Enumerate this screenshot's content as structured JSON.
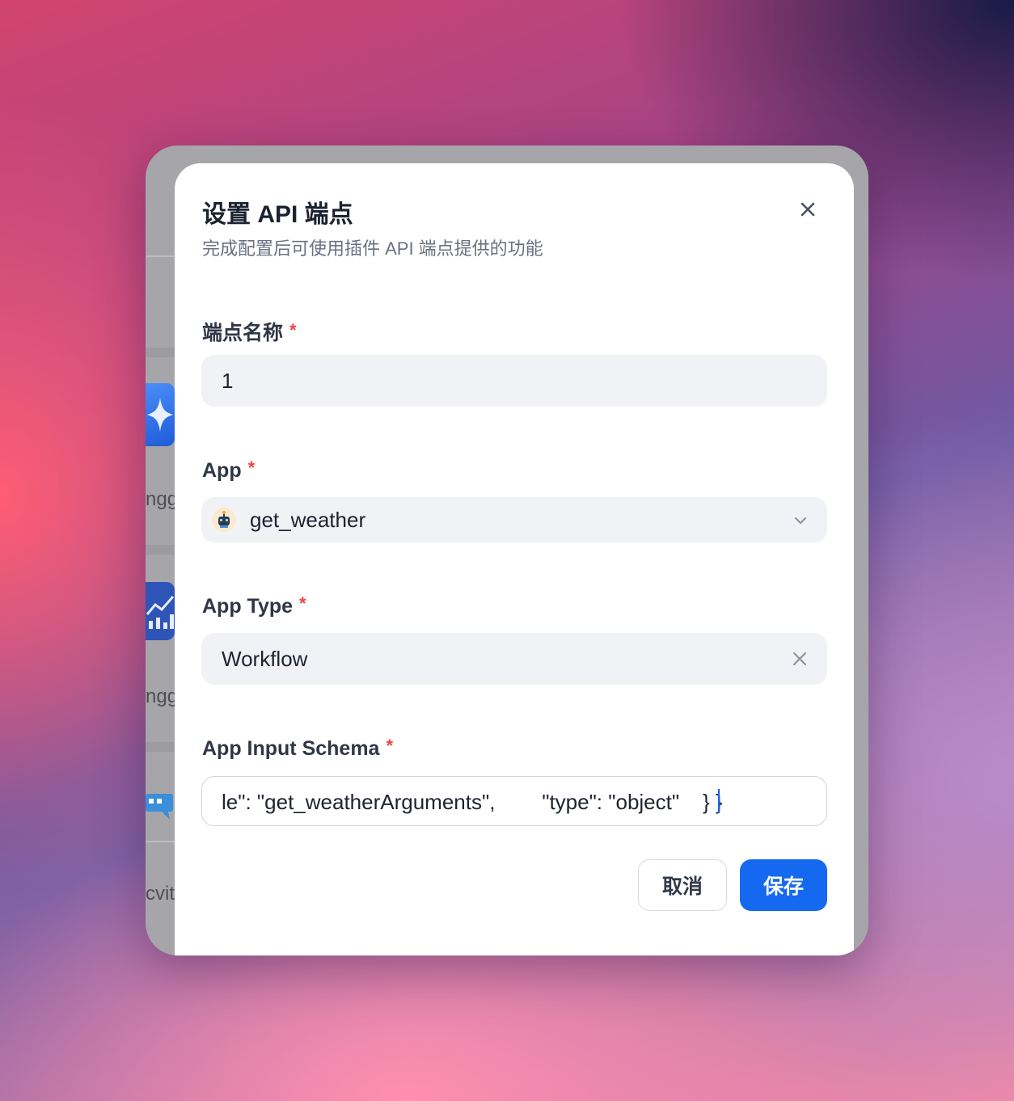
{
  "dialog": {
    "title": "设置 API 端点",
    "subtitle": "完成配置后可使用插件 API 端点提供的功能",
    "close_icon": "close-icon"
  },
  "fields": {
    "endpoint_name": {
      "label": "端点名称",
      "required_mark": "*",
      "value": "1"
    },
    "app": {
      "label": "App",
      "required_mark": "*",
      "value": "get_weather",
      "icon": "robot-icon",
      "chevron_icon": "chevron-down-icon"
    },
    "app_type": {
      "label": "App Type",
      "required_mark": "*",
      "value": "Workflow",
      "clear_icon": "clear-icon"
    },
    "app_input_schema": {
      "label": "App Input Schema",
      "required_mark": "*",
      "value": "le\": \"get_weatherArguments\",        \"type\": \"object\"    } }"
    }
  },
  "buttons": {
    "cancel": "取消",
    "save": "保存"
  },
  "background_list": {
    "truncated_labels": [
      "ngg",
      "ngg",
      "cvit"
    ]
  },
  "colors": {
    "primary": "#1569f0",
    "required": "#ef4444",
    "field_bg": "#f1f2f5"
  }
}
